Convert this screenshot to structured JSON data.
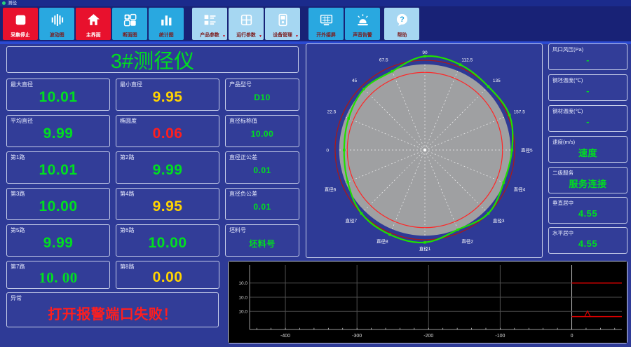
{
  "window": {
    "title": "测径"
  },
  "colors": {
    "green": "#00df20",
    "yellow": "#ffd400",
    "red": "#ff1e1e"
  },
  "toolbar": {
    "buttons": [
      {
        "id": "stop-capture",
        "label": "采集停止",
        "icon": "stop-icon",
        "style": "red"
      },
      {
        "id": "wave-chart",
        "label": "波动图",
        "icon": "waveform-icon",
        "style": "cyan"
      },
      {
        "id": "main-view",
        "label": "主界面",
        "icon": "home-icon",
        "style": "red"
      },
      {
        "id": "section-view",
        "label": "断面图",
        "icon": "windows-grid-icon",
        "style": "cyan"
      },
      {
        "id": "stats-chart",
        "label": "统计图",
        "icon": "bar-chart-icon",
        "style": "cyan"
      },
      {
        "id": "product-params",
        "label": "产品参数",
        "icon": "product-params-icon",
        "style": "light",
        "dropdown": true
      },
      {
        "id": "run-params",
        "label": "运行参数",
        "icon": "run-params-icon",
        "style": "light",
        "dropdown": true
      },
      {
        "id": "device-manage",
        "label": "设备管理",
        "icon": "device-manage-icon",
        "style": "light",
        "dropdown": true
      },
      {
        "id": "external-screen",
        "label": "开外接屏",
        "icon": "external-screen-icon",
        "style": "cyan"
      },
      {
        "id": "sound-alarm",
        "label": "声音告警",
        "icon": "alarm-beacon-icon",
        "style": "cyan"
      },
      {
        "id": "help",
        "label": "帮助",
        "icon": "help-icon",
        "style": "light"
      }
    ]
  },
  "left_panel": {
    "title": "3#测径仪",
    "fields": [
      {
        "id": "max-diameter",
        "label": "最大直径",
        "value": "10.01",
        "color": "green"
      },
      {
        "id": "min-diameter",
        "label": "最小直径",
        "value": "9.95",
        "color": "yellow"
      },
      {
        "id": "product-model",
        "label": "产品型号",
        "value": "D10",
        "color": "green"
      },
      {
        "id": "avg-diameter",
        "label": "平均直径",
        "value": "9.99",
        "color": "green"
      },
      {
        "id": "ovality",
        "label": "椭圆度",
        "value": "0.06",
        "color": "red"
      },
      {
        "id": "nominal-diameter",
        "label": "直径标称值",
        "value": "10.00",
        "color": "green"
      },
      {
        "id": "channel-1",
        "label": "第1路",
        "value": "10.01",
        "color": "green"
      },
      {
        "id": "channel-2",
        "label": "第2路",
        "value": "9.99",
        "color": "green"
      },
      {
        "id": "tolerance-plus",
        "label": "直径正公差",
        "value": "0.01",
        "color": "green"
      },
      {
        "id": "channel-3",
        "label": "第3路",
        "value": "10.00",
        "color": "green"
      },
      {
        "id": "channel-4",
        "label": "第4路",
        "value": "9.95",
        "color": "yellow"
      },
      {
        "id": "tolerance-minus",
        "label": "直径负公差",
        "value": "0.01",
        "color": "green"
      },
      {
        "id": "channel-5",
        "label": "第5路",
        "value": "9.99",
        "color": "green"
      },
      {
        "id": "channel-6",
        "label": "第6路",
        "value": "10.00",
        "color": "green"
      },
      {
        "id": "billet-no",
        "label": "坯料号",
        "value": "坯料号",
        "color": "green"
      },
      {
        "id": "channel-7",
        "label": "第7路",
        "value": "10. 00",
        "color": "green",
        "serif": true
      },
      {
        "id": "channel-8",
        "label": "第8路",
        "value": "0.00",
        "color": "yellow"
      }
    ]
  },
  "alarm": {
    "label": "异常",
    "value": "打开报警端口失败！"
  },
  "right_panel": {
    "fields": [
      {
        "id": "air-pressure",
        "label": "风口风压(Pa)",
        "value": "-"
      },
      {
        "id": "billet-temp",
        "label": "钢坯温度(℃)",
        "value": "-"
      },
      {
        "id": "steel-temp",
        "label": "钢材温度(℃)",
        "value": "-"
      },
      {
        "id": "speed",
        "label": "速度(m/s)",
        "value": "速度"
      },
      {
        "id": "l2-service",
        "label": "二级服务",
        "value": "服务连接"
      },
      {
        "id": "vertical-center",
        "label": "垂直居中",
        "value": "4.55"
      },
      {
        "id": "horizontal-center",
        "label": "水平居中",
        "value": "4.55"
      }
    ]
  },
  "chart_data": [
    {
      "type": "polar-profile",
      "description": "cross-section of measured bar vs tolerance circles",
      "spoke_step_deg": 22.5,
      "spoke_labels_ccw_from_east": [
        "直径5",
        "157.5",
        "135",
        "112.5",
        "90",
        "67.5",
        "45",
        "22.5",
        "0",
        "直径6",
        "直径7",
        "直径8",
        "直径1",
        "直径2",
        "直径3",
        "直径4"
      ],
      "profile_r_frac": [
        0.97,
        1.02,
        1.0,
        1.03,
        1.045,
        0.95,
        0.96,
        0.92,
        0.9,
        0.93,
        1.0,
        1.02,
        1.03,
        0.96,
        1.0,
        0.95
      ],
      "tolerance_outer_frac": 1.0,
      "tolerance_inner_frac": 0.865,
      "disc_frac": 0.955,
      "nominal_diameter": 10.0,
      "tolerance_plus": 0.01,
      "tolerance_minus": 0.01,
      "diameter_values": [
        10.01,
        9.99,
        10.0,
        9.95,
        9.99,
        10.0,
        10.0,
        0.0
      ],
      "colors": {
        "profile": "#1fe000",
        "outer_circle": "#a81a1a",
        "inner_circle": "#ff2626",
        "disc": "#9fa0a2",
        "spokes": "#ffffff"
      }
    },
    {
      "type": "line",
      "description": "diameter trend strip chart",
      "x_range": [
        -450,
        70
      ],
      "x_ticks": [
        -400,
        -300,
        -200,
        -100,
        0
      ],
      "y_tick_labels": [
        "10.0",
        "10.0",
        "10.0"
      ],
      "y_gridline_fracs": [
        0.28,
        0.5,
        0.72
      ],
      "plot_bg": "#000000",
      "series": [
        {
          "name": "upper-limit",
          "color": "#d80000",
          "y_frac": 0.28,
          "x_from": 0,
          "x_to": 70
        },
        {
          "name": "measured",
          "color": "#d80000",
          "y_frac": 0.8,
          "x_from": 0,
          "x_to": 70,
          "spike_x": 22
        }
      ]
    }
  ]
}
